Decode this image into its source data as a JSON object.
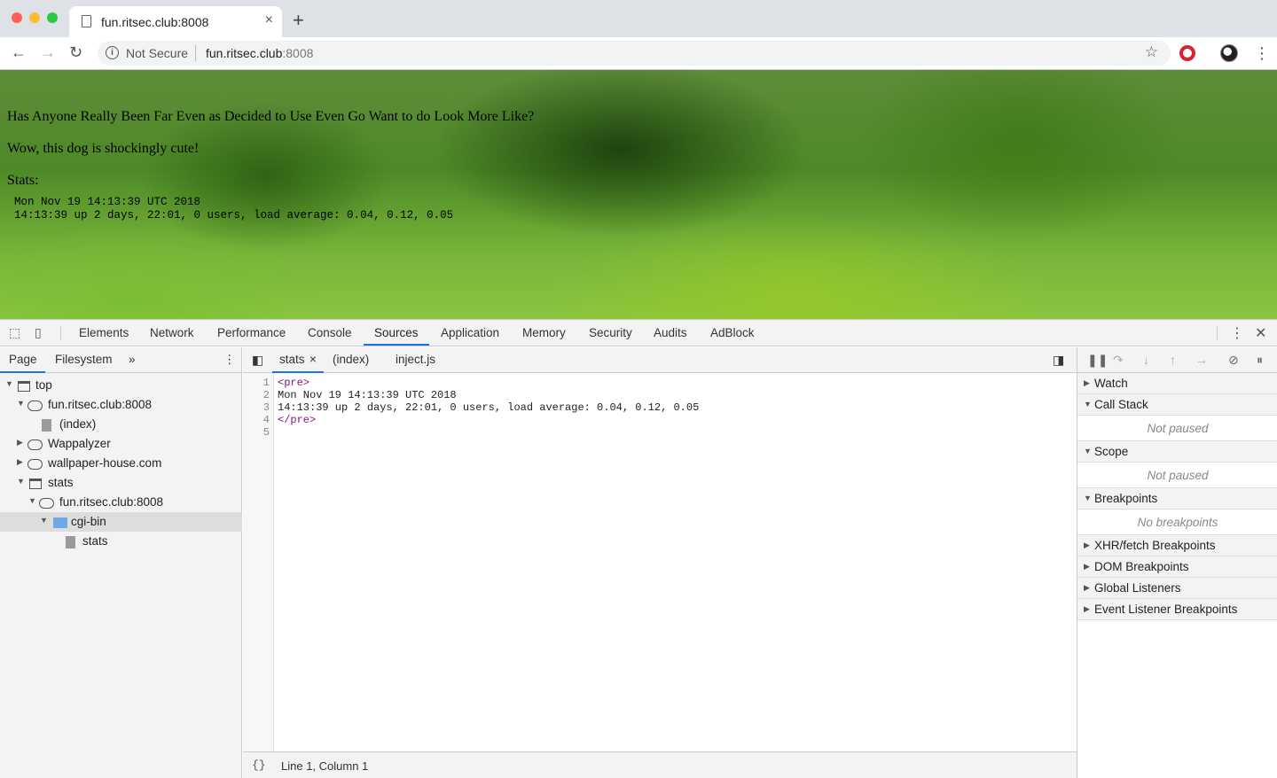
{
  "browser": {
    "tab_title": "fun.ritsec.club:8008",
    "new_tab": "+",
    "tab_close": "×",
    "security_label": "Not Secure",
    "url_host": "fun.ritsec.club",
    "url_port": ":8008"
  },
  "page": {
    "line1": "Has Anyone Really Been Far Even as Decided to Use Even Go Want to do Look More Like?",
    "line2": "Wow, this dog is shockingly cute!",
    "stats_label": "Stats:",
    "stats_pre": "Mon Nov 19 14:13:39 UTC 2018\n14:13:39 up 2 days, 22:01, 0 users, load average: 0.04, 0.12, 0.05"
  },
  "devtools": {
    "tabs": [
      "Elements",
      "Network",
      "Performance",
      "Console",
      "Sources",
      "Application",
      "Memory",
      "Security",
      "Audits",
      "AdBlock"
    ],
    "active_tab": "Sources",
    "navigator": {
      "tabs": [
        "Page",
        "Filesystem"
      ],
      "more": "»",
      "tree": [
        {
          "label": "top"
        },
        {
          "label": "fun.ritsec.club:8008"
        },
        {
          "label": "(index)"
        },
        {
          "label": "Wappalyzer"
        },
        {
          "label": "wallpaper-house.com"
        },
        {
          "label": "stats"
        },
        {
          "label": "fun.ritsec.club:8008"
        },
        {
          "label": "cgi-bin"
        },
        {
          "label": "stats"
        }
      ]
    },
    "editor": {
      "tabs": [
        "stats",
        "(index)",
        "inject.js"
      ],
      "tab_close": "×",
      "lines": [
        "<pre>",
        "Mon Nov 19 14:13:39 UTC 2018",
        "14:13:39 up 2 days, 22:01, 0 users, load average: 0.04, 0.12, 0.05",
        "</pre>",
        ""
      ],
      "line_numbers": [
        "1",
        "2",
        "3",
        "4",
        "5"
      ],
      "braces": "{}",
      "cursor_position": "Line 1, Column 1"
    },
    "debugger": {
      "sections": [
        "Watch",
        "Call Stack",
        "Scope",
        "Breakpoints",
        "XHR/fetch Breakpoints",
        "DOM Breakpoints",
        "Global Listeners",
        "Event Listener Breakpoints"
      ],
      "call_stack_note": "Not paused",
      "scope_note": "Not paused",
      "breakpoints_note": "No breakpoints"
    }
  },
  "colors": {
    "accent": "#1a73e8",
    "tag": "#881280",
    "close_red": "#ff5f57",
    "minimize_yellow": "#febc2e",
    "zoom_green": "#28c840"
  }
}
